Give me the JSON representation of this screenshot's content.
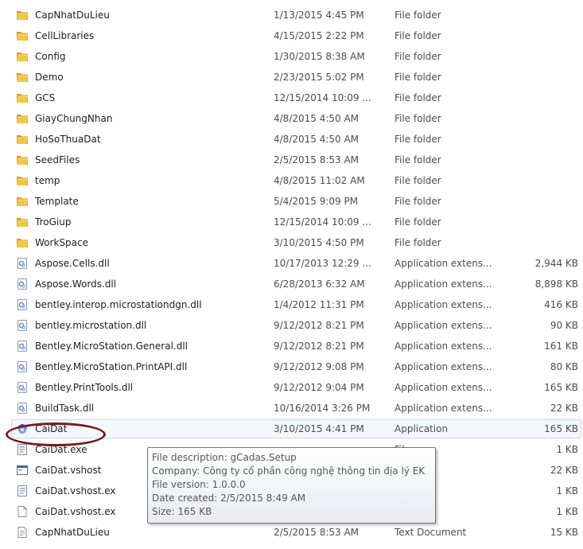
{
  "files": [
    {
      "name": "CapNhatDuLieu",
      "date": "1/13/2015 4:45 PM",
      "type": "File folder",
      "size": "",
      "icon": "folder-icon"
    },
    {
      "name": "CellLibraries",
      "date": "4/15/2015 2:22 PM",
      "type": "File folder",
      "size": "",
      "icon": "folder-icon"
    },
    {
      "name": "Config",
      "date": "1/30/2015 8:38 AM",
      "type": "File folder",
      "size": "",
      "icon": "folder-icon"
    },
    {
      "name": "Demo",
      "date": "2/23/2015 5:02 PM",
      "type": "File folder",
      "size": "",
      "icon": "folder-icon"
    },
    {
      "name": "GCS",
      "date": "12/15/2014 10:09 ...",
      "type": "File folder",
      "size": "",
      "icon": "folder-icon"
    },
    {
      "name": "GiayChungNhan",
      "date": "4/8/2015 4:50 AM",
      "type": "File folder",
      "size": "",
      "icon": "folder-icon"
    },
    {
      "name": "HoSoThuaDat",
      "date": "4/8/2015 4:50 AM",
      "type": "File folder",
      "size": "",
      "icon": "folder-icon"
    },
    {
      "name": "SeedFiles",
      "date": "2/5/2015 8:53 AM",
      "type": "File folder",
      "size": "",
      "icon": "folder-icon"
    },
    {
      "name": "temp",
      "date": "4/8/2015 11:02 AM",
      "type": "File folder",
      "size": "",
      "icon": "folder-icon"
    },
    {
      "name": "Template",
      "date": "5/4/2015 9:09 PM",
      "type": "File folder",
      "size": "",
      "icon": "folder-icon"
    },
    {
      "name": "TroGiup",
      "date": "12/15/2014 10:09 ...",
      "type": "File folder",
      "size": "",
      "icon": "folder-icon"
    },
    {
      "name": "WorkSpace",
      "date": "3/10/2015 4:50 PM",
      "type": "File folder",
      "size": "",
      "icon": "folder-icon"
    },
    {
      "name": "Aspose.Cells.dll",
      "date": "10/17/2013 12:29 ...",
      "type": "Application extens...",
      "size": "2,944 KB",
      "icon": "dll-icon"
    },
    {
      "name": "Aspose.Words.dll",
      "date": "6/28/2013 6:32 AM",
      "type": "Application extens...",
      "size": "8,898 KB",
      "icon": "dll-icon"
    },
    {
      "name": "bentley.interop.microstationdgn.dll",
      "date": "1/4/2012 11:31 PM",
      "type": "Application extens...",
      "size": "416 KB",
      "icon": "dll-icon"
    },
    {
      "name": "bentley.microstation.dll",
      "date": "9/12/2012 8:21 PM",
      "type": "Application extens...",
      "size": "90 KB",
      "icon": "dll-icon"
    },
    {
      "name": "Bentley.MicroStation.General.dll",
      "date": "9/12/2012 8:21 PM",
      "type": "Application extens...",
      "size": "161 KB",
      "icon": "dll-icon"
    },
    {
      "name": "Bentley.MicroStation.PrintAPI.dll",
      "date": "9/12/2012 9:08 PM",
      "type": "Application extens...",
      "size": "80 KB",
      "icon": "dll-icon"
    },
    {
      "name": "Bentley.PrintTools.dll",
      "date": "9/12/2012 9:04 PM",
      "type": "Application extens...",
      "size": "165 KB",
      "icon": "dll-icon"
    },
    {
      "name": "BuildTask.dll",
      "date": "10/16/2014 3:26 PM",
      "type": "Application extens...",
      "size": "22 KB",
      "icon": "dll-icon"
    },
    {
      "name": "CaiDat",
      "date": "3/10/2015 4:41 PM",
      "type": "Application",
      "size": "165 KB",
      "icon": "app-icon",
      "selected": true
    },
    {
      "name": "CaiDat.exe",
      "date": "",
      "type": "File",
      "size": "1 KB",
      "icon": "config-file-icon"
    },
    {
      "name": "CaiDat.vshost",
      "date": "",
      "type": "ion",
      "size": "22 KB",
      "icon": "vshost-exe-icon"
    },
    {
      "name": "CaiDat.vshost.ex",
      "date": "",
      "type": "File",
      "size": "1 KB",
      "icon": "config-file-icon"
    },
    {
      "name": "CaiDat.vshost.ex",
      "date": "",
      "type": "ST File",
      "size": "1 KB",
      "icon": "blank-file-icon"
    },
    {
      "name": "CapNhatDuLieu",
      "date": "2/5/2015 8:53 AM",
      "type": "Text Document",
      "size": "15 KB",
      "icon": "text-file-icon"
    }
  ],
  "tooltip": {
    "description": "File description: gCadas.Setup",
    "company": "Company: Công ty cổ phần công nghệ thông tin địa lý EK",
    "version": "File version: 1.0.0.0",
    "created": "Date created: 2/5/2015 8:49 AM",
    "size": "Size: 165 KB"
  },
  "colors": {
    "highlight": "#7a1a1a",
    "folder": "#e8b429",
    "selection_border": "#c3d9f1"
  }
}
